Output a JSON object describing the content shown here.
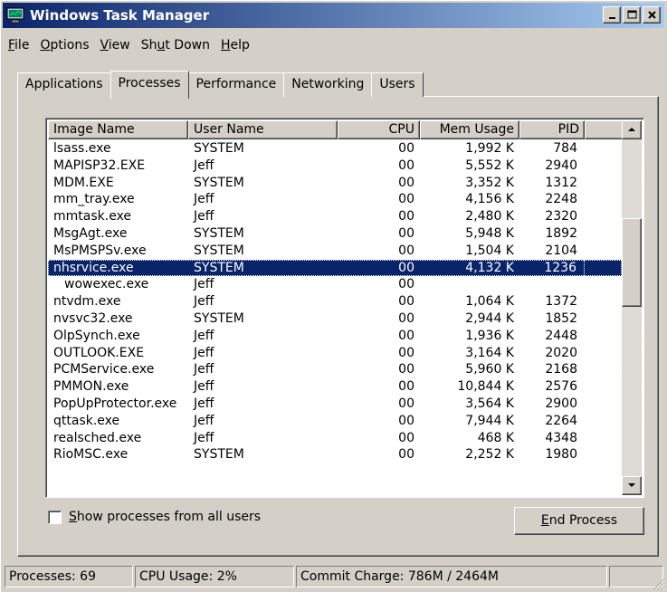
{
  "window": {
    "title": "Windows Task Manager",
    "icon": "task-manager-icon",
    "caption_buttons": [
      "minimize-icon",
      "maximize-icon",
      "close-icon"
    ]
  },
  "menu": [
    {
      "label": "File",
      "accel": "F",
      "rest": "ile"
    },
    {
      "label": "Options",
      "accel": "O",
      "rest": "ptions"
    },
    {
      "label": "View",
      "accel": "V",
      "rest": "iew"
    },
    {
      "label": "Shut Down",
      "pre": "Sh",
      "accel": "u",
      "rest": "t Down"
    },
    {
      "label": "Help",
      "accel": "H",
      "rest": "elp"
    }
  ],
  "tabs": [
    "Applications",
    "Processes",
    "Performance",
    "Networking",
    "Users"
  ],
  "active_tab": "Processes",
  "columns": {
    "name": "Image Name",
    "user": "User Name",
    "cpu": "CPU",
    "mem": "Mem Usage",
    "pid": "PID"
  },
  "processes": [
    {
      "name": "lsass.exe",
      "user": "SYSTEM",
      "cpu": "00",
      "mem": "1,992 K",
      "pid": "784"
    },
    {
      "name": "MAPISP32.EXE",
      "user": "Jeff",
      "cpu": "00",
      "mem": "5,552 K",
      "pid": "2940"
    },
    {
      "name": "MDM.EXE",
      "user": "SYSTEM",
      "cpu": "00",
      "mem": "3,352 K",
      "pid": "1312"
    },
    {
      "name": "mm_tray.exe",
      "user": "Jeff",
      "cpu": "00",
      "mem": "4,156 K",
      "pid": "2248"
    },
    {
      "name": "mmtask.exe",
      "user": "Jeff",
      "cpu": "00",
      "mem": "2,480 K",
      "pid": "2320"
    },
    {
      "name": "MsgAgt.exe",
      "user": "SYSTEM",
      "cpu": "00",
      "mem": "5,948 K",
      "pid": "1892"
    },
    {
      "name": "MsPMSPSv.exe",
      "user": "SYSTEM",
      "cpu": "00",
      "mem": "1,504 K",
      "pid": "2104"
    },
    {
      "name": "nhsrvice.exe",
      "user": "SYSTEM",
      "cpu": "00",
      "mem": "4,132 K",
      "pid": "1236",
      "selected": true
    },
    {
      "name": "wowexec.exe",
      "user": "Jeff",
      "cpu": "00",
      "mem": "",
      "pid": "",
      "indent": true
    },
    {
      "name": "ntvdm.exe",
      "user": "Jeff",
      "cpu": "00",
      "mem": "1,064 K",
      "pid": "1372"
    },
    {
      "name": "nvsvc32.exe",
      "user": "SYSTEM",
      "cpu": "00",
      "mem": "2,944 K",
      "pid": "1852"
    },
    {
      "name": "OlpSynch.exe",
      "user": "Jeff",
      "cpu": "00",
      "mem": "1,936 K",
      "pid": "2448"
    },
    {
      "name": "OUTLOOK.EXE",
      "user": "Jeff",
      "cpu": "00",
      "mem": "3,164 K",
      "pid": "2020"
    },
    {
      "name": "PCMService.exe",
      "user": "Jeff",
      "cpu": "00",
      "mem": "5,960 K",
      "pid": "2168"
    },
    {
      "name": "PMMON.exe",
      "user": "Jeff",
      "cpu": "00",
      "mem": "10,844 K",
      "pid": "2576"
    },
    {
      "name": "PopUpProtector.exe",
      "user": "Jeff",
      "cpu": "00",
      "mem": "3,564 K",
      "pid": "2900"
    },
    {
      "name": "qttask.exe",
      "user": "Jeff",
      "cpu": "00",
      "mem": "7,944 K",
      "pid": "2264"
    },
    {
      "name": "realsched.exe",
      "user": "Jeff",
      "cpu": "00",
      "mem": "468 K",
      "pid": "4348"
    },
    {
      "name": "RioMSC.exe",
      "user": "SYSTEM",
      "cpu": "00",
      "mem": "2,252 K",
      "pid": "1980"
    }
  ],
  "show_all_users": {
    "label": "Show processes from all users",
    "accel": "S",
    "rest": "how processes from all users",
    "checked": false
  },
  "end_process": {
    "label": "End Process",
    "accel": "E",
    "rest": "nd Process"
  },
  "status": {
    "processes": "Processes: 69",
    "cpu": "CPU Usage: 2%",
    "commit": "Commit Charge: 786M / 2464M"
  },
  "colors": {
    "title_start": "#0a246a",
    "title_end": "#a6caf0",
    "selection": "#0a246a",
    "face": "#d4d0c8"
  }
}
